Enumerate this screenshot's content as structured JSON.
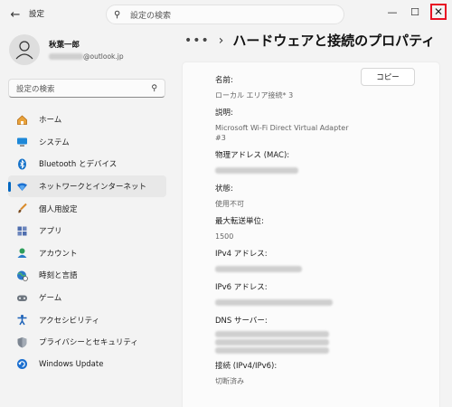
{
  "titlebar": {
    "app_title": "設定",
    "search_placeholder": "設定の検索"
  },
  "user": {
    "name": "秋葉一郎",
    "email_suffix": "@outlook.jp"
  },
  "sidebar": {
    "search_placeholder": "設定の検索",
    "items": [
      {
        "label": "ホーム",
        "icon": "home-icon"
      },
      {
        "label": "システム",
        "icon": "monitor-icon"
      },
      {
        "label": "Bluetooth とデバイス",
        "icon": "bluetooth-icon"
      },
      {
        "label": "ネットワークとインターネット",
        "icon": "wifi-icon",
        "active": true
      },
      {
        "label": "個人用設定",
        "icon": "brush-icon"
      },
      {
        "label": "アプリ",
        "icon": "apps-icon"
      },
      {
        "label": "アカウント",
        "icon": "account-icon"
      },
      {
        "label": "時刻と言語",
        "icon": "globe-clock-icon"
      },
      {
        "label": "ゲーム",
        "icon": "gamepad-icon"
      },
      {
        "label": "アクセシビリティ",
        "icon": "accessibility-icon"
      },
      {
        "label": "プライバシーとセキュリティ",
        "icon": "shield-icon"
      },
      {
        "label": "Windows Update",
        "icon": "update-icon"
      }
    ]
  },
  "header": {
    "more": "•••",
    "separator": "›",
    "title": "ハードウェアと接続のプロパティ"
  },
  "properties": {
    "copy_label": "コピー",
    "name_label": "名前:",
    "name_value": "ローカル エリア接続* 3",
    "desc_label": "説明:",
    "desc_value": "Microsoft Wi-Fi Direct Virtual Adapter #3",
    "mac_label": "物理アドレス (MAC):",
    "status_label": "状態:",
    "status_value": "使用不可",
    "mtu_label": "最大転送単位:",
    "mtu_value": "1500",
    "ipv4_label": "IPv4 アドレス:",
    "ipv6_label": "IPv6 アドレス:",
    "dns_label": "DNS サーバー:",
    "conn_label": "接続 (IPv4/IPv6):",
    "conn_value": "切断済み"
  },
  "colors": {
    "accent": "#0067c0",
    "close_highlight": "#e81123"
  }
}
